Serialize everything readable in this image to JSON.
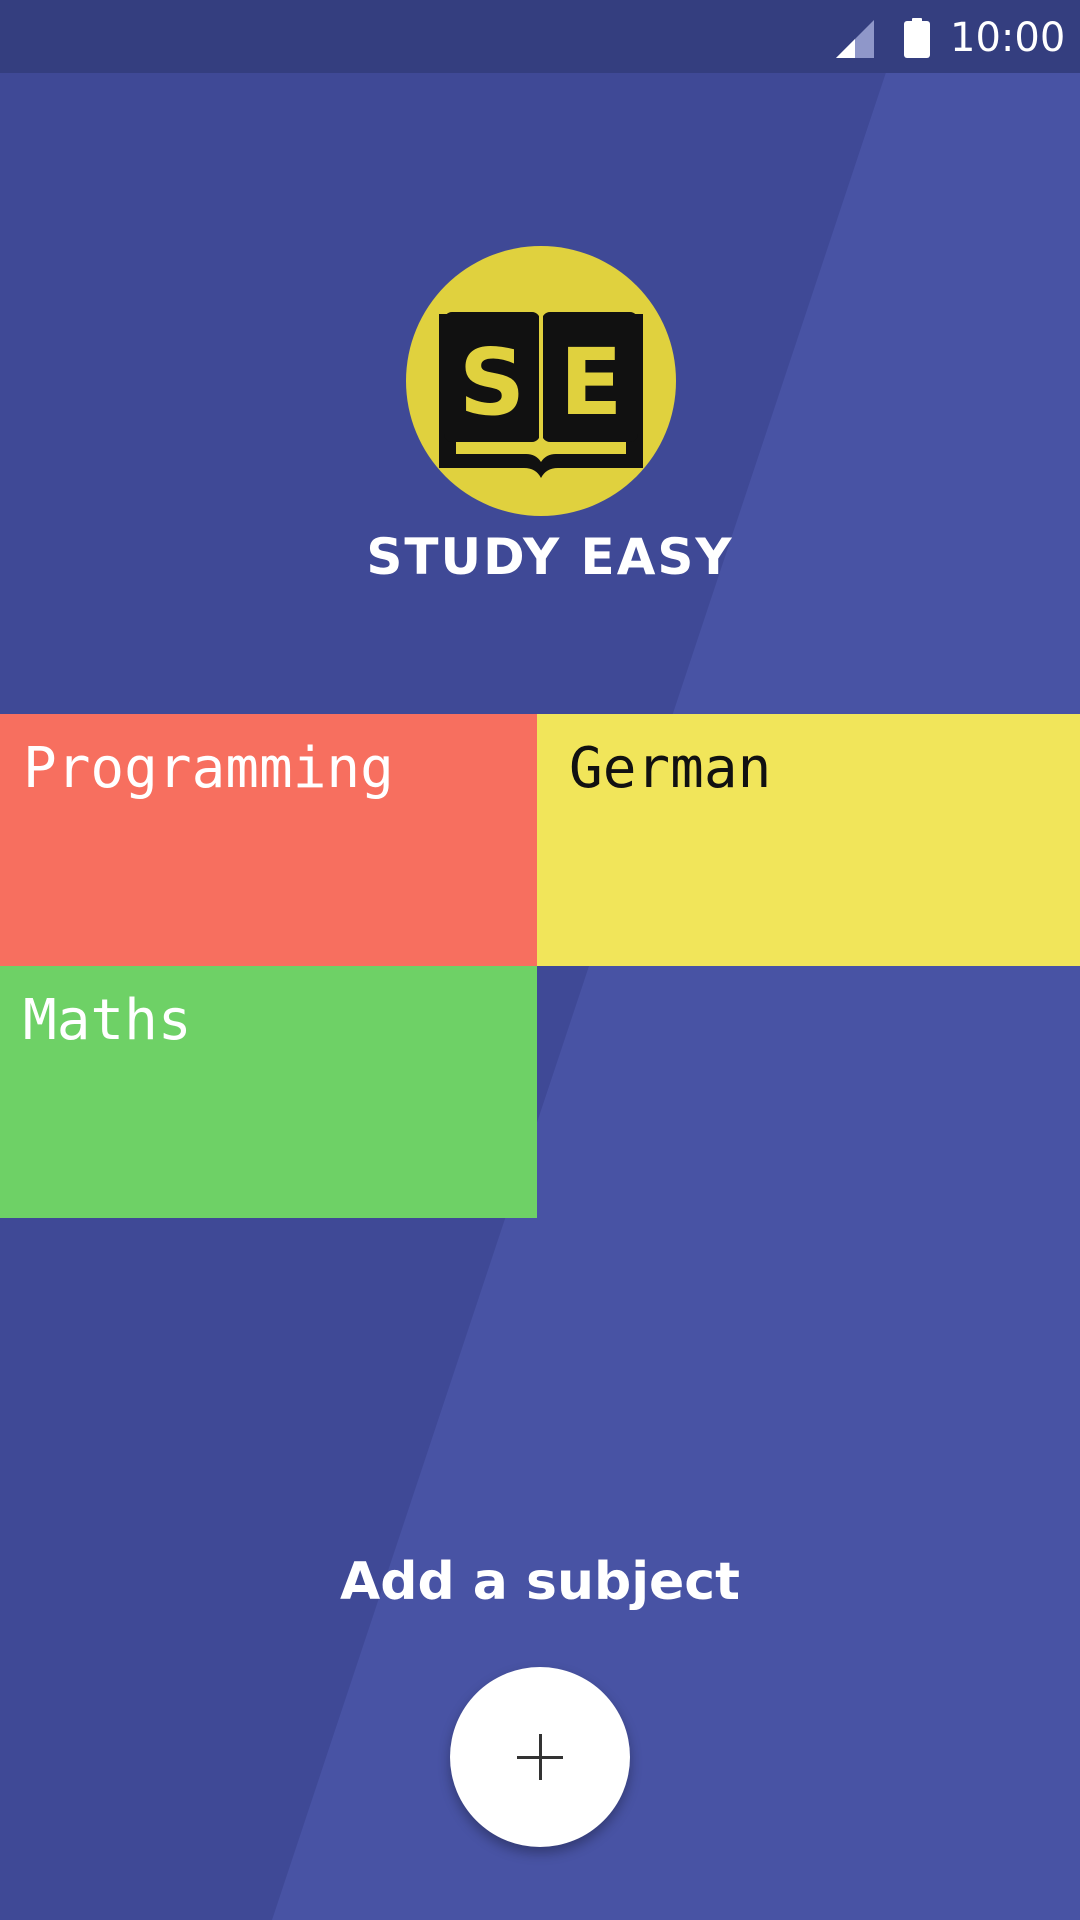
{
  "status_bar": {
    "time": "10:00",
    "signal_icon": "cell-signal-icon",
    "battery_icon": "battery-icon"
  },
  "app": {
    "title": "STUDY EASY",
    "logo_text": "SE",
    "logo_icon": "open-book-icon"
  },
  "subjects": [
    {
      "label": "Programming",
      "color": "#f76f5f"
    },
    {
      "label": "German",
      "color": "#f1e55a"
    },
    {
      "label": "Maths",
      "color": "#6ed166"
    }
  ],
  "add_subject": {
    "label": "Add a subject",
    "icon": "plus-icon"
  },
  "colors": {
    "background": "#3f4996",
    "background_light": "#4853a4",
    "status_bar": "#343e7f",
    "logo": "#e0d13e"
  }
}
